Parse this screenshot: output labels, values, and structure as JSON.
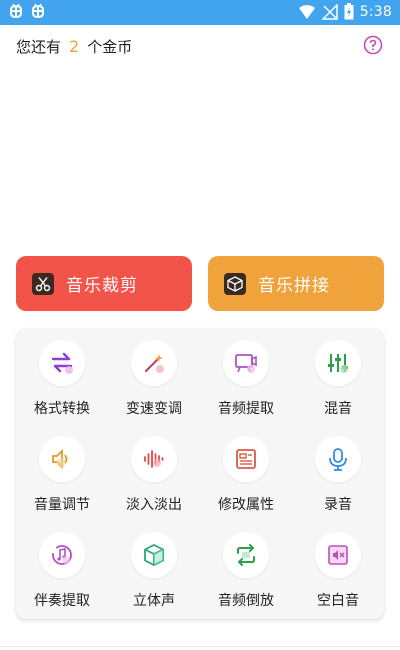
{
  "status_bar": {
    "time": "5:38"
  },
  "header": {
    "coins_prefix": "您还有",
    "coins_count": "2",
    "coins_suffix": "个金币"
  },
  "actions": {
    "cut_label": "音乐裁剪",
    "join_label": "音乐拼接"
  },
  "tools": [
    {
      "label": "格式转换",
      "icon": "swap-arrows-icon"
    },
    {
      "label": "变速变调",
      "icon": "magic-wand-icon"
    },
    {
      "label": "音频提取",
      "icon": "projector-icon"
    },
    {
      "label": "混音",
      "icon": "equalizer-icon"
    },
    {
      "label": "音量调节",
      "icon": "volume-icon"
    },
    {
      "label": "淡入淡出",
      "icon": "waveform-icon"
    },
    {
      "label": "修改属性",
      "icon": "edit-file-icon"
    },
    {
      "label": "录音",
      "icon": "microphone-icon"
    },
    {
      "label": "伴奏提取",
      "icon": "music-disc-icon"
    },
    {
      "label": "立体声",
      "icon": "cube-icon"
    },
    {
      "label": "音频倒放",
      "icon": "repeat-icon"
    },
    {
      "label": "空白音",
      "icon": "mute-file-icon"
    }
  ],
  "colors": {
    "status_bar": "#42a4ee",
    "accent_orange": "#f0a33a",
    "accent_red": "#f2544a",
    "help_icon": "#c050b8"
  }
}
